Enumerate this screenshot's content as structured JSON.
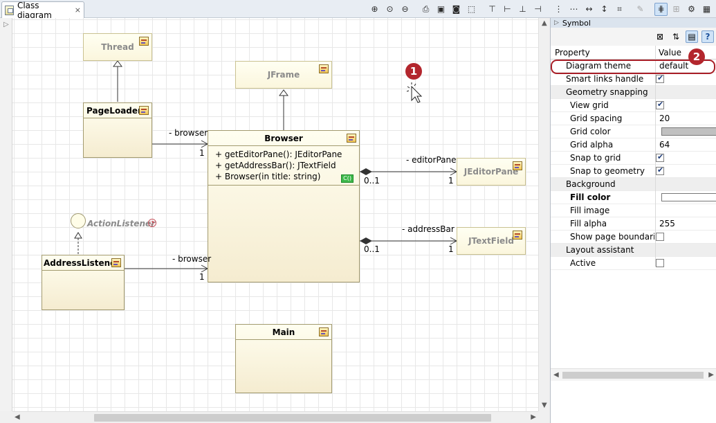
{
  "tab": {
    "title": "Class diagram",
    "close": "⨯"
  },
  "toolbar": {
    "buttons": [
      {
        "name": "zoom-in-icon",
        "glyph": "⊕"
      },
      {
        "name": "zoom-fit-icon",
        "glyph": "⊙"
      },
      {
        "name": "zoom-out-icon",
        "glyph": "⊖"
      },
      {
        "name": "print-icon",
        "glyph": "⎙"
      },
      {
        "name": "save-icon",
        "glyph": "▣"
      },
      {
        "name": "camera-icon",
        "glyph": "◙"
      },
      {
        "name": "page-setup-icon",
        "glyph": "⬚"
      },
      {
        "name": "align-top-icon",
        "glyph": "⊤"
      },
      {
        "name": "align-left-icon",
        "glyph": "⊢"
      },
      {
        "name": "align-bottom-icon",
        "glyph": "⊥"
      },
      {
        "name": "align-right-icon",
        "glyph": "⊣"
      },
      {
        "name": "distribute-vertical-icon",
        "glyph": "⋮"
      },
      {
        "name": "distribute-horizontal-icon",
        "glyph": "⋯"
      },
      {
        "name": "same-width-icon",
        "glyph": "↔"
      },
      {
        "name": "same-height-icon",
        "glyph": "↕"
      },
      {
        "name": "arrange-icon",
        "glyph": "⌗"
      },
      {
        "name": "edit-pencil-icon",
        "glyph": "✎"
      },
      {
        "name": "grid-snap-icon",
        "glyph": "⋕"
      },
      {
        "name": "grid-icon",
        "glyph": "⊞"
      },
      {
        "name": "settings-icon",
        "glyph": "⚙"
      },
      {
        "name": "more-icon",
        "glyph": "▦"
      }
    ]
  },
  "diagram": {
    "classes": {
      "thread": "Thread",
      "jframe": "JFrame",
      "pageloader": "PageLoader",
      "browser": "Browser",
      "jeditorpane": "JEditorPane",
      "jtextfield": "JTextField",
      "addresslistener": "AddressListener",
      "main": "Main"
    },
    "interface_name": "ActionListener",
    "browser_operations": [
      "+ getEditorPane(): JEditorPane",
      "+ getAddressBar(): JTextField",
      "+ Browser(in title: string)"
    ],
    "constructor_badge": "C()",
    "associations": {
      "pageloader_role": "- browser",
      "pageloader_mult": "1",
      "addresslistener_role": "- browser",
      "addresslistener_mult": "1",
      "editorpane_role": "- editorPane",
      "editorpane_src_mult": "0..1",
      "editorpane_dst_mult": "1",
      "addressbar_role": "- addressBar",
      "addressbar_src_mult": "0..1",
      "addressbar_dst_mult": "1"
    },
    "step_badges": [
      "1",
      "2"
    ]
  },
  "panel": {
    "title": "Symbol",
    "columns": {
      "property": "Property",
      "value": "Value"
    },
    "rows": [
      {
        "kind": "prop",
        "label": "Diagram theme",
        "value": "default"
      },
      {
        "kind": "check",
        "label": "Smart links handle",
        "checked": true
      },
      {
        "kind": "group",
        "label": "Geometry snapping"
      },
      {
        "kind": "check",
        "label": "View grid",
        "checked": true
      },
      {
        "kind": "prop",
        "label": "Grid spacing",
        "value": "20"
      },
      {
        "kind": "color",
        "label": "Grid color",
        "color": "#c0c0c0"
      },
      {
        "kind": "prop",
        "label": "Grid alpha",
        "value": "64"
      },
      {
        "kind": "check",
        "label": "Snap to grid",
        "checked": true
      },
      {
        "kind": "check",
        "label": "Snap to geometry",
        "checked": true
      },
      {
        "kind": "group",
        "label": "Background"
      },
      {
        "kind": "color",
        "label": "Fill color",
        "color": "#ffffff",
        "bold": true
      },
      {
        "kind": "prop",
        "label": "Fill image",
        "value": ""
      },
      {
        "kind": "prop",
        "label": "Fill alpha",
        "value": "255"
      },
      {
        "kind": "check",
        "label": "Show page boundaries",
        "checked": false
      },
      {
        "kind": "group",
        "label": "Layout assistant"
      },
      {
        "kind": "check",
        "label": "Active",
        "checked": false
      }
    ]
  },
  "colors": {
    "highlight": "#a91e27",
    "badge": "#b3262d",
    "grid_swatch": "#c0c0c0",
    "accent_blue": "#cfe3f7"
  }
}
